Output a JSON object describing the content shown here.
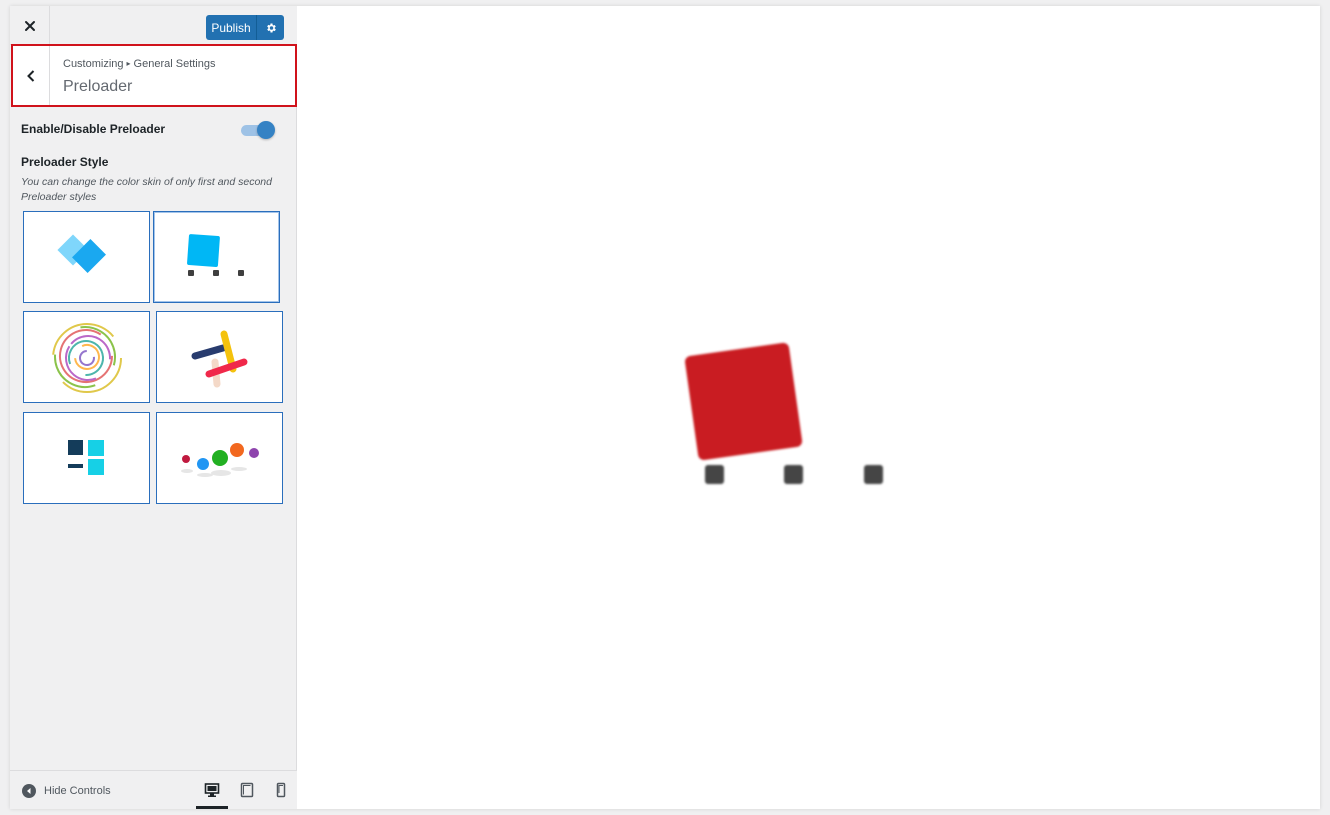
{
  "header": {
    "close_icon": "close-icon",
    "publish_label": "Publish",
    "settings_icon": "gear-icon"
  },
  "section": {
    "breadcrumb_root": "Customizing",
    "breadcrumb_separator": "▸",
    "breadcrumb_parent": "General Settings",
    "title": "Preloader",
    "back_icon": "chevron-left-icon"
  },
  "controls": {
    "enable_label": "Enable/Disable Preloader",
    "enable_on": true,
    "style_label": "Preloader Style",
    "style_description": "You can change the color skin of only first and second Preloader styles",
    "styles": [
      {
        "id": "style-1",
        "icon": "diamond-heart-icon",
        "selected": false
      },
      {
        "id": "style-2",
        "icon": "square-dots-icon",
        "selected": true
      },
      {
        "id": "style-3",
        "icon": "spiral-icon",
        "selected": false
      },
      {
        "id": "style-4",
        "icon": "crossed-bars-icon",
        "selected": false
      },
      {
        "id": "style-5",
        "icon": "blocks-icon",
        "selected": false
      },
      {
        "id": "style-6",
        "icon": "colored-dots-icon",
        "selected": false
      }
    ]
  },
  "footer": {
    "hide_controls_label": "Hide Controls",
    "devices": [
      "desktop-icon",
      "tablet-icon",
      "mobile-icon"
    ],
    "active_device": "desktop"
  },
  "preview": {
    "loader": "square-dots-preloader",
    "square_color": "#c91a24",
    "dot_color": "#444444"
  },
  "colors": {
    "accent": "#2271b1",
    "highlight_border": "#d0121b"
  }
}
